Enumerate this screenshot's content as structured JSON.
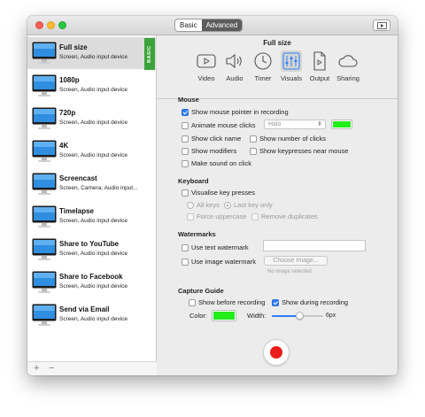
{
  "titlebar": {
    "mode_basic": "Basic",
    "mode_advanced": "Advanced"
  },
  "sidebar": {
    "basic_tag": "BASIC",
    "presets": [
      {
        "name": "Full size",
        "desc": "Screen, Audio input device"
      },
      {
        "name": "1080p",
        "desc": "Screen, Audio input device"
      },
      {
        "name": "720p",
        "desc": "Screen, Audio input device"
      },
      {
        "name": "4K",
        "desc": "Screen, Audio input device"
      },
      {
        "name": "Screencast",
        "desc": "Screen, Camera, Audio input..."
      },
      {
        "name": "Timelapse",
        "desc": "Screen, Audio input device"
      },
      {
        "name": "Share to YouTube",
        "desc": "Screen, Audio input device"
      },
      {
        "name": "Share to Facebook",
        "desc": "Screen, Audio input device"
      },
      {
        "name": "Send via Email",
        "desc": "Screen, Audio input device"
      }
    ],
    "add": "+",
    "remove": "−"
  },
  "toolbar": {
    "title": "Full size",
    "tabs": [
      "Video",
      "Audio",
      "Timer",
      "Visuals",
      "Output",
      "Sharing"
    ]
  },
  "mouse": {
    "heading": "Mouse",
    "show_pointer": "Show mouse pointer in recording",
    "animate_clicks": "Animate mouse clicks",
    "animation_style": "Halo",
    "show_click_name": "Show click name",
    "show_click_count": "Show number of clicks",
    "show_modifiers": "Show modifiers",
    "show_keypresses": "Show keypresses near mouse",
    "make_sound": "Make sound on click"
  },
  "keyboard": {
    "heading": "Keyboard",
    "visualise": "Visualise key presses",
    "all_keys": "All keys",
    "last_key": "Last key only",
    "force_upper": "Force uppercase",
    "remove_dupes": "Remove duplicates"
  },
  "watermarks": {
    "heading": "Watermarks",
    "text_wm": "Use text watermark",
    "image_wm": "Use image watermark",
    "choose_image": "Choose Image...",
    "no_image": "No image selected."
  },
  "capture": {
    "heading": "Capture Guide",
    "before": "Show before recording",
    "during": "Show during recording",
    "color_label": "Color:",
    "width_label": "Width:",
    "width_value": "6px",
    "width_fraction": 0.55
  },
  "colors": {
    "accent": "#2d7ef6",
    "green": "#22ee1a",
    "record": "#ea1c1c",
    "basic_tag": "#3ba33a"
  }
}
